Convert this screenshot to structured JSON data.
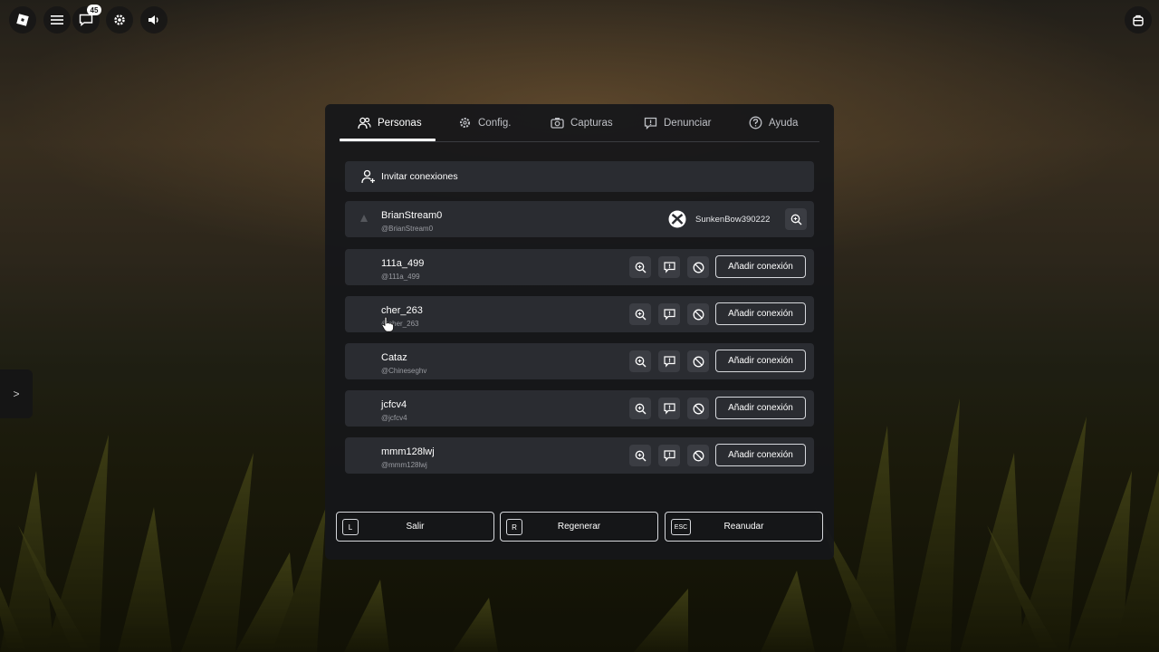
{
  "colors": {
    "panel_bg": "#16171a",
    "row_bg": "#2a2c31",
    "icon_btn_bg": "#3b3d43",
    "text_muted": "#9a9ca2"
  },
  "topbar": {
    "icons": [
      "roblox-logo-icon",
      "menu-icon",
      "chat-icon",
      "gear-icon",
      "speaker-icon",
      "backpack-icon"
    ],
    "chat_badge": "45"
  },
  "side_tab": {
    "label": ">"
  },
  "tabs": [
    {
      "label": "Personas",
      "icon": "people-icon",
      "active": true
    },
    {
      "label": "Config.",
      "icon": "gear-icon",
      "active": false
    },
    {
      "label": "Capturas",
      "icon": "camera-icon",
      "active": false
    },
    {
      "label": "Denunciar",
      "icon": "flag-report-icon",
      "active": false
    },
    {
      "label": "Ayuda",
      "icon": "help-icon",
      "active": false
    }
  ],
  "invite": {
    "label": "Invitar conexiones"
  },
  "self_player": {
    "name": "BrianStream0",
    "handle": "@BrianStream0",
    "xbox_gamertag": "SunkenBow390222"
  },
  "players": [
    {
      "name": "111a_499",
      "handle": "@111a_499",
      "action": "Añadir conexión"
    },
    {
      "name": "cher_263",
      "handle": "@cher_263",
      "action": "Añadir conexión"
    },
    {
      "name": "Cataz",
      "handle": "@Chineseghv",
      "action": "Añadir conexión"
    },
    {
      "name": "jcfcv4",
      "handle": "@jcfcv4",
      "action": "Añadir conexión"
    },
    {
      "name": "mmm128lwj",
      "handle": "@mmm128lwj",
      "action": "Añadir conexión"
    }
  ],
  "bottom_buttons": [
    {
      "key": "L",
      "label": "Salir"
    },
    {
      "key": "R",
      "label": "Regenerar"
    },
    {
      "key": "ESC",
      "label": "Reanudar"
    }
  ]
}
